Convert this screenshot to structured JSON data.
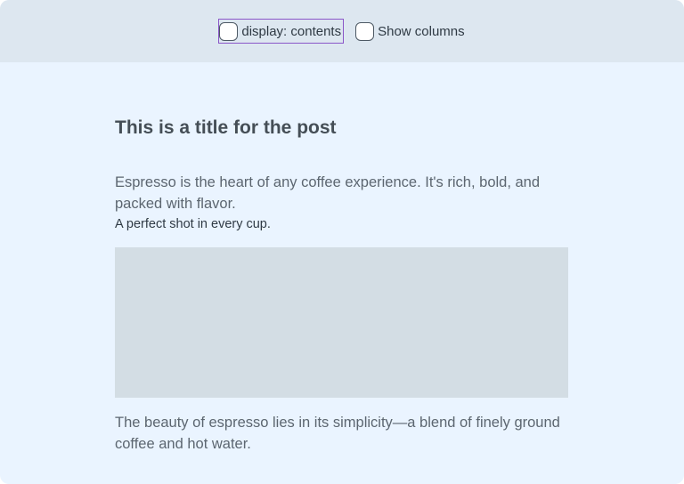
{
  "controls": {
    "display_contents_label": "display: contents",
    "show_columns_label": "Show columns"
  },
  "post": {
    "title": "This is a title for the post",
    "lead_paragraph": "Espresso is the heart of any coffee experience. It's rich, bold, and packed with flavor.",
    "tagline": "A perfect shot in every cup.",
    "body_paragraph": "The beauty of espresso lies in its simplicity—a blend of finely ground coffee and hot water."
  },
  "colors": {
    "page_background": "#eaf4ff",
    "toolbar_background": "#dde7f0",
    "image_placeholder": "#d3dde4",
    "focus_outline": "#8a56c8"
  }
}
